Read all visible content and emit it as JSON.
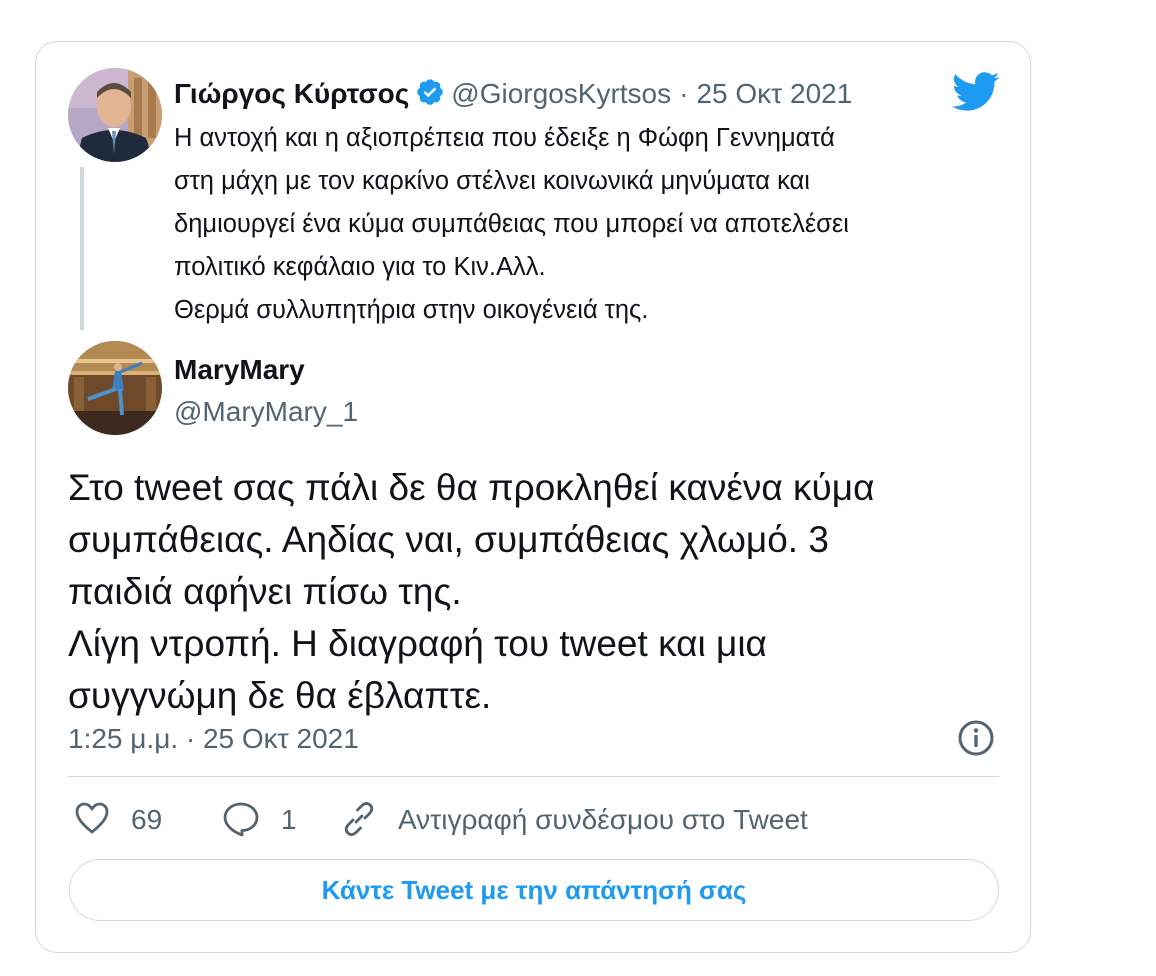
{
  "quoted_tweet": {
    "author_name": "Γιώργος Κύρτσος",
    "handle": "@GiorgosKyrtsos",
    "separator": "·",
    "date": "25 Οκτ 2021",
    "text": "Η αντοχή και η αξιοπρέπεια που έδειξε η Φώφη Γεννηματά\nστη μάχη με τον καρκίνο στέλνει κοινωνικά μηνύματα και\nδημιουργεί ένα κύμα συμπάθειας που μπορεί να αποτελέσει\nπολιτικό κεφάλαιο για το Κιν.Αλλ.\nΘερμά συλλυπητήρια στην οικογένειά της.",
    "verified": true
  },
  "reply_tweet": {
    "author_name": "MaryMary",
    "handle": "@MaryMary_1",
    "text": "Στο tweet σας πάλι δε θα προκληθεί κανένα κύμα\nσυμπάθειας. Αηδίας ναι, συμπάθειας χλωμό. 3\nπαιδιά αφήνει πίσω της.\nΛίγη ντροπή. Η διαγραφή του tweet και μια\nσυγγνώμη δε θα έβλαπτε.",
    "timestamp": "1:25 μ.μ. · 25 Οκτ 2021"
  },
  "actions": {
    "likes": "69",
    "replies": "1",
    "copy_link_label": "Αντιγραφή συνδέσμου στο Tweet"
  },
  "reply_button_label": "Κάντε Tweet με την απάντησή σας",
  "icons": {
    "brand": "twitter-bird-icon",
    "like": "heart-icon",
    "reply": "speech-bubble-icon",
    "link": "link-icon",
    "info": "info-icon",
    "verified": "verified-badge-icon"
  },
  "colors": {
    "accent": "#1d9bf0",
    "text": "#0f1419",
    "secondary": "#536471",
    "border": "#cfd9de"
  }
}
